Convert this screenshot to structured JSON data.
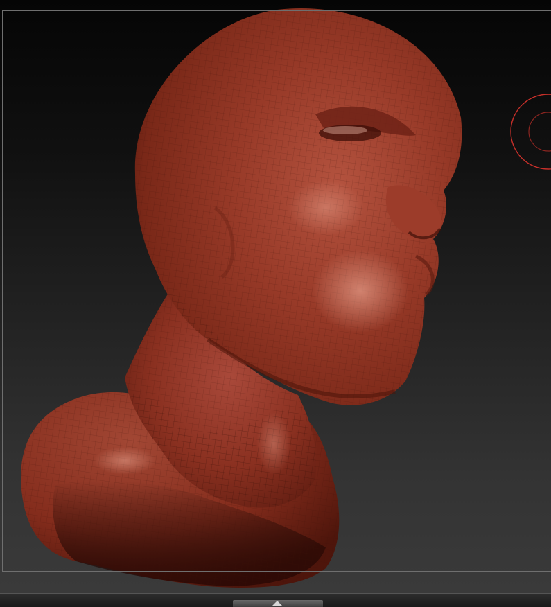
{
  "viewport": {
    "background_top": "#050505",
    "background_bottom": "#3a3a3a",
    "frame_color": "#6f6f6f"
  },
  "model": {
    "kind": "sculpted-head-bust",
    "material_base": "#8e3322",
    "material_highlight": "#c8735e",
    "material_shadow": "#3e0f08",
    "wireframe_visible": true
  },
  "navigation_gizmo": {
    "icon": "rotate-gizmo-icon",
    "color": "#c8302a"
  },
  "bottom_shelf": {
    "handle_icon": "expand-shelf-arrow-icon"
  }
}
